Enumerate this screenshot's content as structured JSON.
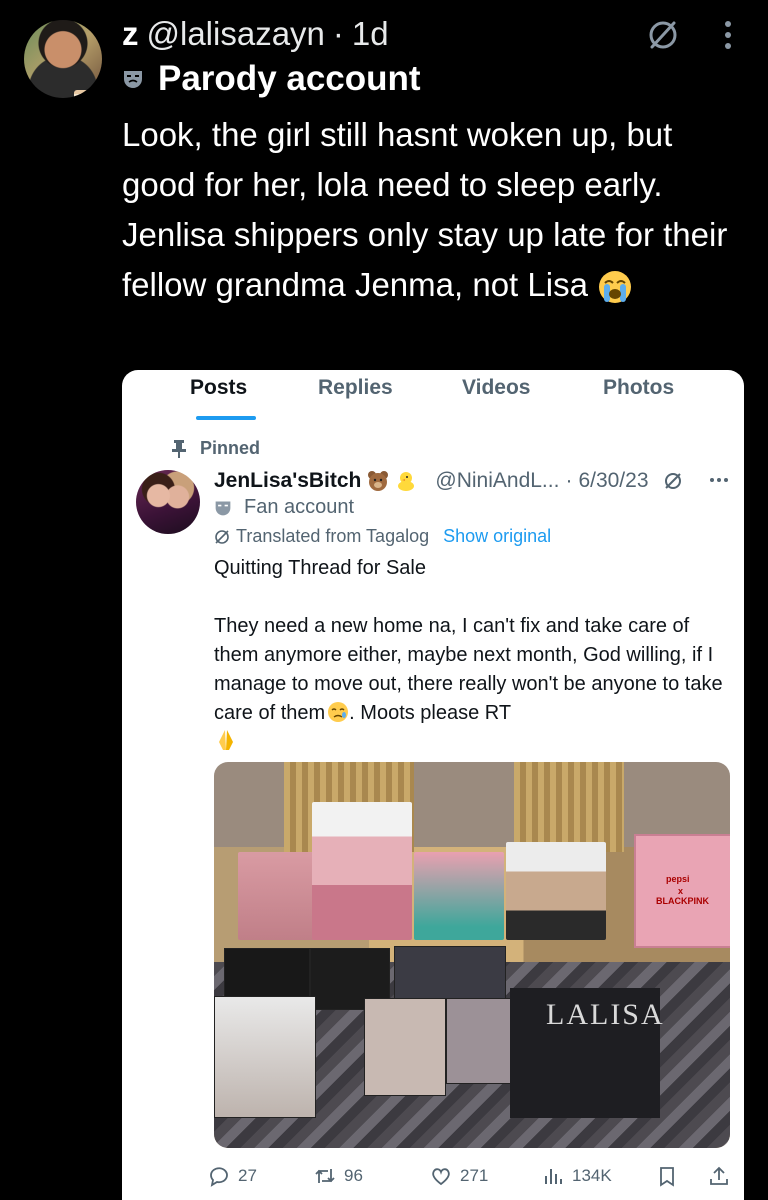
{
  "tweet": {
    "display_name": "z",
    "handle": "@lalisazayn",
    "separator": "·",
    "time": "1d",
    "parody_label": "Parody account",
    "text": "Look, the girl still hasnt woken up, but good for her, lola need to sleep early. Jenlisa shippers only stay up late for their fellow grandma Jenma, not Lisa",
    "emoji": "loudly-crying-face-icon"
  },
  "embed": {
    "tabs": [
      {
        "label": "Posts",
        "active": true
      },
      {
        "label": "Replies",
        "active": false
      },
      {
        "label": "Videos",
        "active": false
      },
      {
        "label": "Photos",
        "active": false
      }
    ],
    "pinned_label": "Pinned",
    "post": {
      "display_name": "JenLisa'sBitch",
      "handle": "@NiniAndL...",
      "separator": "·",
      "date": "6/30/23",
      "account_label": "Fan account",
      "translated_label": "Translated from Tagalog",
      "show_original": "Show original",
      "text": "Quitting Thread for Sale\n\nThey need a new home na, I can't fix and take care of them anymore either, maybe next month, God willing, if I manage to move out, there really won't be anyone to take care of them",
      "text_tail": ". Moots please RT",
      "photo_text": {
        "album": "LALISA",
        "box_brand": "pepsi",
        "box_x": "x",
        "box_group": "BLACKPINK"
      }
    },
    "actions": {
      "replies": "27",
      "reposts": "96",
      "likes": "271",
      "views": "134K"
    }
  },
  "colors": {
    "accent": "#1d9bf0",
    "muted": "#536471",
    "background": "#000000"
  }
}
